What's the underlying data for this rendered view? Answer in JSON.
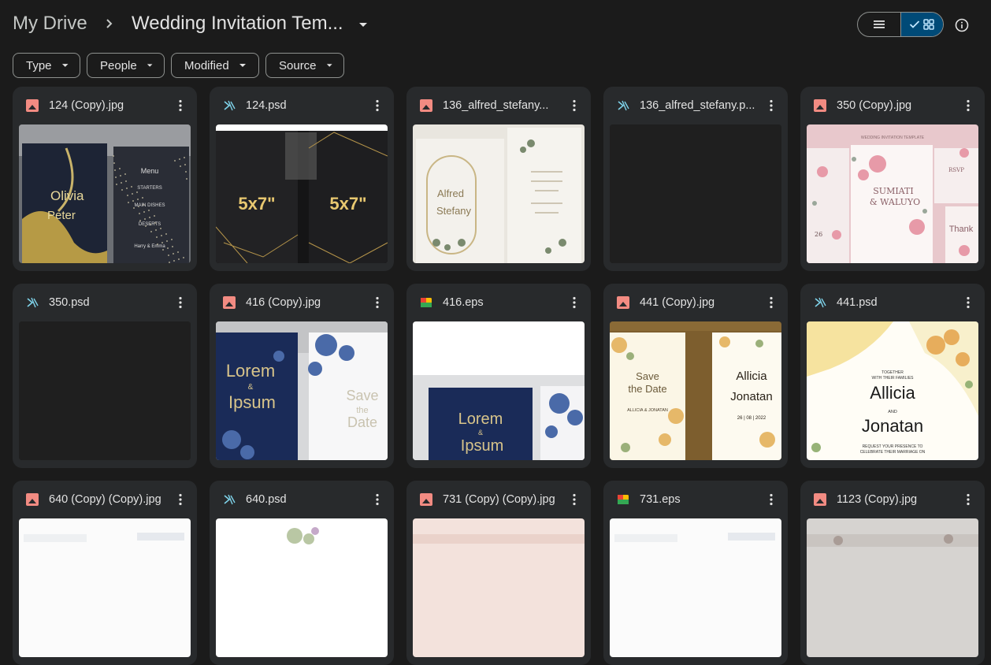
{
  "breadcrumb": {
    "root": "My Drive",
    "current": "Wedding Invitation Tem..."
  },
  "filters": [
    "Type",
    "People",
    "Modified",
    "Source"
  ],
  "files": [
    {
      "name": "124 (Copy).jpg",
      "type": "image",
      "thumb": "navy-gold-menu",
      "thumb_text": [
        "Olivia",
        "Peter",
        "Menu",
        "STARTERS",
        "MAIN DISHES",
        "DESERTS",
        "Harry & Emma"
      ]
    },
    {
      "name": "124.psd",
      "type": "psd",
      "thumb": "dark-5x7",
      "thumb_text": [
        "5x7\"",
        "5x7\""
      ]
    },
    {
      "name": "136_alfred_stefany...",
      "type": "image",
      "thumb": "cream-arch",
      "thumb_text": [
        "Alfred",
        "Stefany"
      ]
    },
    {
      "name": "136_alfred_stefany.p...",
      "type": "psd",
      "thumb": "blank-dark",
      "thumb_text": []
    },
    {
      "name": "350 (Copy).jpg",
      "type": "image",
      "thumb": "pink-floral",
      "thumb_text": [
        "WEDDING INVITATION TEMPLATE",
        "SUMIATI",
        "& WALUYO",
        "RSVP",
        "Thank",
        "26"
      ]
    },
    {
      "name": "350.psd",
      "type": "psd",
      "thumb": "blank-dark",
      "thumb_text": []
    },
    {
      "name": "416 (Copy).jpg",
      "type": "image",
      "thumb": "navy-blue-roses",
      "thumb_text": [
        "Lorem",
        "&",
        "Ipsum",
        "Save",
        "the",
        "Date"
      ]
    },
    {
      "name": "416.eps",
      "type": "eps",
      "thumb": "white-navy",
      "thumb_text": [
        "Lorem",
        "&",
        "Ipsum"
      ]
    },
    {
      "name": "441 (Copy).jpg",
      "type": "image",
      "thumb": "gold-watercolor",
      "thumb_text": [
        "Save",
        "the Date",
        "ALLICIA & JONATAN",
        "Allicia",
        "Jonatan",
        "26 | 08 | 2022"
      ]
    },
    {
      "name": "441.psd",
      "type": "psd",
      "thumb": "yellow-watercolor",
      "thumb_text": [
        "TOGETHER",
        "WITH THEIR FAMILIES",
        "Allicia",
        "AND",
        "Jonatan",
        "REQUEST YOUR PRESENCE TO",
        "CELEBRATE THEIR MARRIAGE ON"
      ]
    },
    {
      "name": "640 (Copy) (Copy).jpg",
      "type": "image",
      "thumb": "white",
      "thumb_text": []
    },
    {
      "name": "640.psd",
      "type": "psd",
      "thumb": "white-floral",
      "thumb_text": []
    },
    {
      "name": "731 (Copy) (Copy).jpg",
      "type": "image",
      "thumb": "blush",
      "thumb_text": []
    },
    {
      "name": "731.eps",
      "type": "eps",
      "thumb": "white",
      "thumb_text": []
    },
    {
      "name": "1123 (Copy).jpg",
      "type": "image",
      "thumb": "grey-floral",
      "thumb_text": []
    }
  ],
  "colors": {
    "accent": "#004a77",
    "image_icon": "#f28b82",
    "psd_icon": "#7fd3ea",
    "surface": "#282a2c"
  }
}
